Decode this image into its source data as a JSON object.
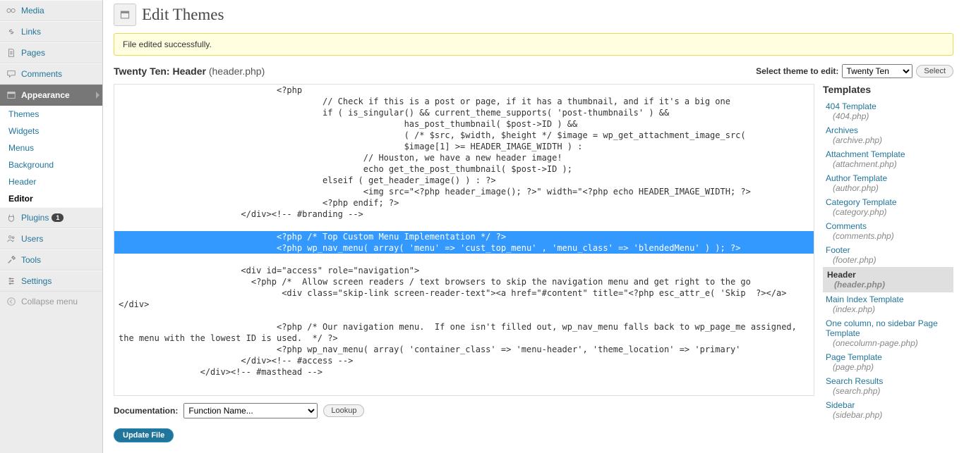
{
  "sidebar": {
    "items": [
      {
        "label": "Media",
        "icon": "media"
      },
      {
        "label": "Links",
        "icon": "link"
      },
      {
        "label": "Pages",
        "icon": "page"
      },
      {
        "label": "Comments",
        "icon": "comment"
      },
      {
        "label": "Appearance",
        "icon": "appearance",
        "active": true
      },
      {
        "label": "Plugins",
        "icon": "plugin",
        "badge": "1"
      },
      {
        "label": "Users",
        "icon": "users"
      },
      {
        "label": "Tools",
        "icon": "tools"
      },
      {
        "label": "Settings",
        "icon": "settings"
      }
    ],
    "submenu": [
      {
        "label": "Themes"
      },
      {
        "label": "Widgets"
      },
      {
        "label": "Menus"
      },
      {
        "label": "Background"
      },
      {
        "label": "Header"
      },
      {
        "label": "Editor",
        "active": true
      }
    ],
    "collapse": "Collapse menu"
  },
  "header": {
    "title": "Edit Themes"
  },
  "notice": "File edited successfully.",
  "file_title": {
    "theme": "Twenty Ten:",
    "name": "Header",
    "file": "(header.php)"
  },
  "theme_select": {
    "label": "Select theme to edit:",
    "value": "Twenty Ten",
    "button": "Select"
  },
  "code": {
    "lines": [
      "                               <?php",
      "                                        // Check if this is a post or page, if it has a thumbnail, and if it's a big one",
      "                                        if ( is_singular() && current_theme_supports( 'post-thumbnails' ) &&",
      "                                                        has_post_thumbnail( $post->ID ) &&",
      "                                                        ( /* $src, $width, $height */ $image = wp_get_attachment_image_src(",
      "                                                        $image[1] >= HEADER_IMAGE_WIDTH ) :",
      "                                                // Houston, we have a new header image!",
      "                                                echo get_the_post_thumbnail( $post->ID );",
      "                                        elseif ( get_header_image() ) : ?>",
      "                                                <img src=\"<?php header_image(); ?>\" width=\"<?php echo HEADER_IMAGE_WIDTH; ?>",
      "                                        <?php endif; ?>",
      "                        </div><!-- #branding -->",
      "",
      "                               <?php /* Top Custom Menu Implementation */ ?>",
      "                               <?php wp_nav_menu( array( 'menu' => 'cust_top_menu' , 'menu_class' => 'blendedMenu' ) ); ?>",
      "",
      "                        <div id=\"access\" role=\"navigation\">",
      "                          <?php /*  Allow screen readers / text browsers to skip the navigation menu and get right to the go",
      "                                <div class=\"skip-link screen-reader-text\"><a href=\"#content\" title=\"<?php esc_attr_e( 'Skip  ?></a>",
      "</div>",
      "",
      "                               <?php /* Our navigation menu.  If one isn't filled out, wp_nav_menu falls back to wp_page_me assigned,",
      "the menu with the lowest ID is used.  */ ?>",
      "                               <?php wp_nav_menu( array( 'container_class' => 'menu-header', 'theme_location' => 'primary'",
      "                        </div><!-- #access -->",
      "                </div><!-- #masthead -->"
    ],
    "highlighted": [
      13,
      14
    ]
  },
  "docs": {
    "label": "Documentation:",
    "select": "Function Name...",
    "lookup": "Lookup"
  },
  "update_button": "Update File",
  "templates": {
    "heading": "Templates",
    "list": [
      {
        "name": "404 Template",
        "file": "(404.php)"
      },
      {
        "name": "Archives",
        "file": "(archive.php)"
      },
      {
        "name": "Attachment Template",
        "file": "(attachment.php)"
      },
      {
        "name": "Author Template",
        "file": "(author.php)"
      },
      {
        "name": "Category Template",
        "file": "(category.php)"
      },
      {
        "name": "Comments",
        "file": "(comments.php)"
      },
      {
        "name": "Footer",
        "file": "(footer.php)"
      },
      {
        "name": "Header",
        "file": "(header.php)",
        "active": true
      },
      {
        "name": "Main Index Template",
        "file": "(index.php)"
      },
      {
        "name": "One column, no sidebar Page Template",
        "file": "(onecolumn-page.php)"
      },
      {
        "name": "Page Template",
        "file": "(page.php)"
      },
      {
        "name": "Search Results",
        "file": "(search.php)"
      },
      {
        "name": "Sidebar",
        "file": "(sidebar.php)"
      }
    ]
  }
}
